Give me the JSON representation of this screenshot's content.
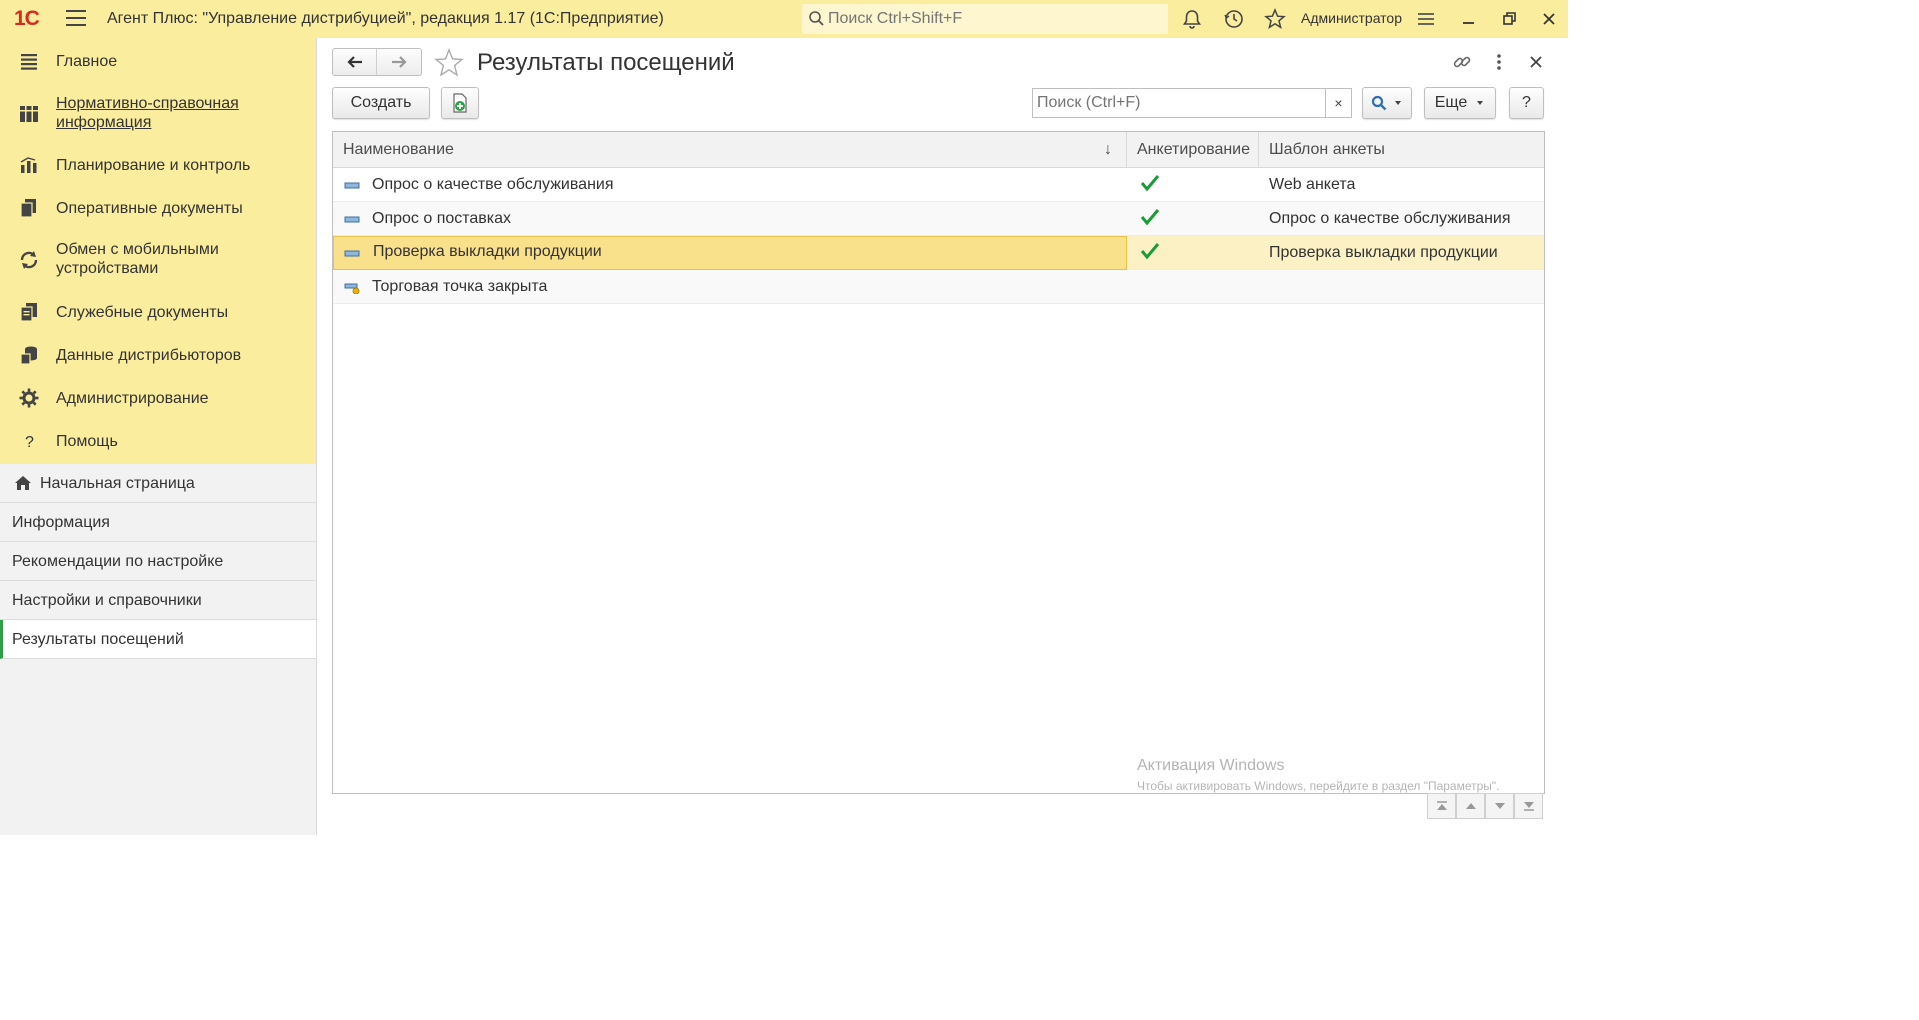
{
  "titlebar": {
    "logo": "1С",
    "app_title": "Агент Плюс: \"Управление дистрибуцией\", редакция 1.17  (1С:Предприятие)",
    "search_placeholder": "Поиск Ctrl+Shift+F",
    "user": "Администратор"
  },
  "sidebar": {
    "sections": [
      {
        "label": "Главное",
        "icon": "list-icon"
      },
      {
        "label": "Нормативно-справочная информация",
        "icon": "reference-books-icon"
      },
      {
        "label": "Планирование и контроль",
        "icon": "bar-chart-icon"
      },
      {
        "label": "Оперативные документы",
        "icon": "documents-icon"
      },
      {
        "label": "Обмен с мобильными устройствами",
        "icon": "sync-icon"
      },
      {
        "label": "Служебные документы",
        "icon": "service-documents-icon"
      },
      {
        "label": "Данные дистрибьюторов",
        "icon": "distributor-data-icon"
      },
      {
        "label": "Администрирование",
        "icon": "gear-icon"
      },
      {
        "label": "Помощь",
        "icon": "help-icon"
      }
    ],
    "open_windows": [
      {
        "label": "Начальная страница"
      },
      {
        "label": "Информация"
      },
      {
        "label": "Рекомендации по настройке"
      },
      {
        "label": "Настройки и справочники"
      },
      {
        "label": "Результаты посещений"
      }
    ]
  },
  "form": {
    "title": "Результаты посещений",
    "create_label": "Создать",
    "search_placeholder": "Поиск (Ctrl+F)",
    "clear_label": "×",
    "more_label": "Еще",
    "help_label": "?"
  },
  "table": {
    "columns": [
      "Наименование",
      "Анкетирование",
      "Шаблон анкеты"
    ],
    "sort_indicator": "↓",
    "rows": [
      {
        "name": "Опрос о качестве обслуживания",
        "survey": true,
        "template": "Web анкета"
      },
      {
        "name": "Опрос о поставках",
        "survey": true,
        "template": "Опрос о качестве обслуживания"
      },
      {
        "name": "Проверка выкладки продукции",
        "survey": true,
        "template": "Проверка выкладки продукции"
      },
      {
        "name": "Торговая точка закрыта",
        "survey": false,
        "template": ""
      }
    ],
    "selected_row": 2
  },
  "watermark": {
    "line1": "Активация Windows",
    "line2": "Чтобы активировать Windows, перейдите в раздел \"Параметры\"."
  },
  "colors": {
    "accent_yellow": "#fbed9e",
    "selection": "#f9e08a",
    "check_green": "#1a9b3a",
    "logo_red": "#d62b1f"
  }
}
